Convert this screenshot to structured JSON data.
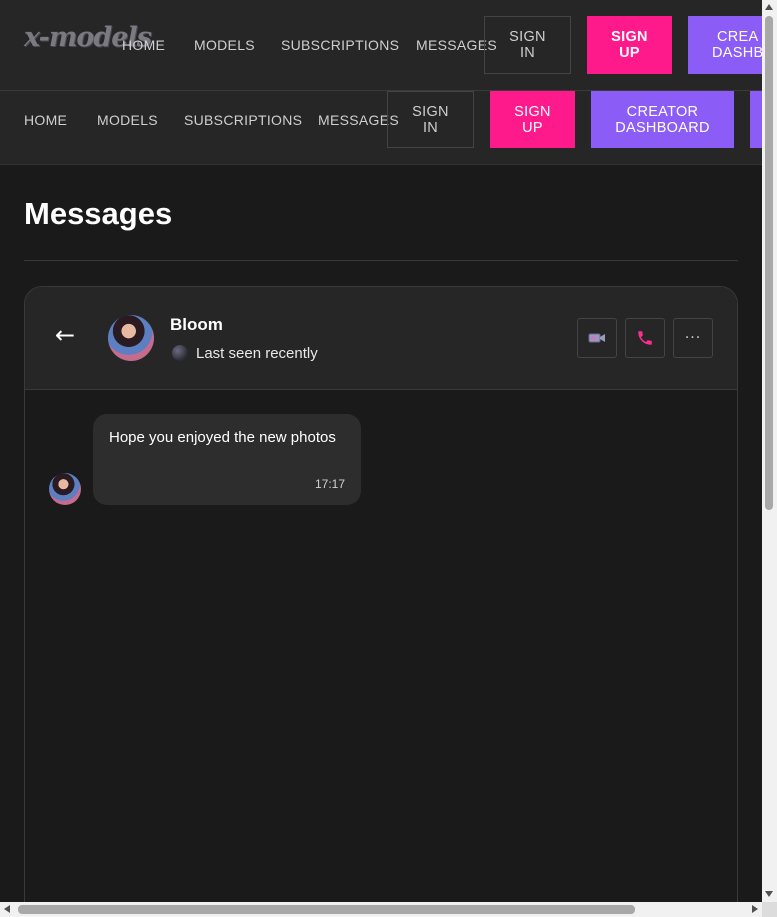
{
  "header": {
    "logo": "x-models",
    "nav": [
      "HOME",
      "MODELS",
      "SUBSCRIPTIONS",
      "MESSAGES"
    ],
    "sign_in": "SIGN\nIN",
    "sign_up": "SIGN\nUP",
    "creator_dashboard_partial": "CREA\nDASHB"
  },
  "subnav": {
    "nav": [
      "HOME",
      "MODELS",
      "SUBSCRIPTIONS",
      "MESSAGES"
    ],
    "sign_in": "SIGN\nIN",
    "sign_up": "SIGN\nUP",
    "creator_dashboard": "CREATOR\nDASHBOARD"
  },
  "page": {
    "title": "Messages"
  },
  "chat": {
    "contact_name": "Bloom",
    "status": "Last seen recently",
    "messages": [
      {
        "text": "Hope you enjoyed the new photos",
        "time": "17:17"
      }
    ]
  },
  "icons": {
    "back": "←",
    "more": "···"
  },
  "colors": {
    "accent_pink": "#ff1a8c",
    "accent_purple": "#8b5cf6",
    "background": "#1a1a1a",
    "panel": "#262626"
  }
}
